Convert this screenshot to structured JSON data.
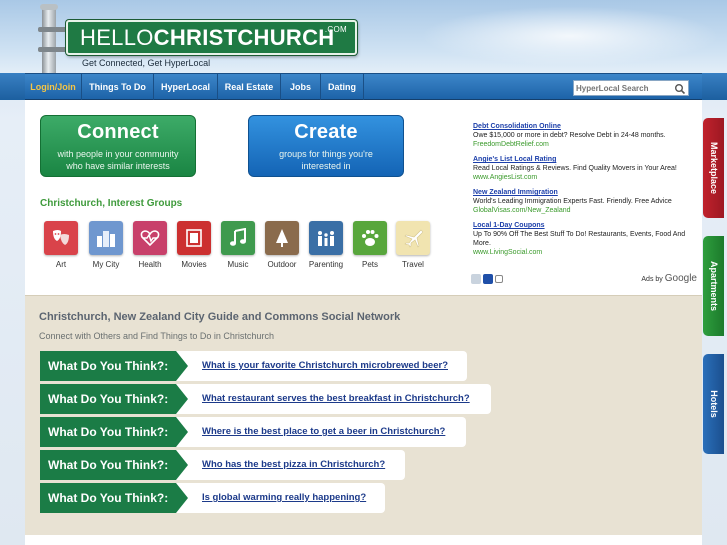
{
  "header": {
    "logo_part1": "HELLO",
    "logo_part2": "CHRISTCHURCH",
    "logo_suffix": ".COM",
    "tagline": "Get Connected, Get HyperLocal"
  },
  "nav": {
    "items": [
      {
        "label": "Login/Join"
      },
      {
        "label": "Things To Do"
      },
      {
        "label": "HyperLocal"
      },
      {
        "label": "Real Estate"
      },
      {
        "label": "Jobs"
      },
      {
        "label": "Dating"
      }
    ],
    "search_placeholder": "HyperLocal Search"
  },
  "connect": {
    "title": "Connect",
    "line1": "with people in your community",
    "line2": "who have similar interests"
  },
  "create": {
    "title": "Create",
    "line1": "groups for things you're",
    "line2": "interested in"
  },
  "groups": {
    "title": "Christchurch, Interest Groups",
    "items": [
      {
        "label": "Art",
        "icon": "masks-icon",
        "color": "#d9434a"
      },
      {
        "label": "My City",
        "icon": "city-icon",
        "color": "#6f97cf"
      },
      {
        "label": "Health",
        "icon": "heart-icon",
        "color": "#c8406a"
      },
      {
        "label": "Movies",
        "icon": "film-icon",
        "color": "#cc3030"
      },
      {
        "label": "Music",
        "icon": "music-note-icon",
        "color": "#3f9a4e"
      },
      {
        "label": "Outdoor",
        "icon": "tree-icon",
        "color": "#8a6b4c"
      },
      {
        "label": "Parenting",
        "icon": "family-icon",
        "color": "#3a6fa6"
      },
      {
        "label": "Pets",
        "icon": "paw-icon",
        "color": "#58a63c"
      },
      {
        "label": "Travel",
        "icon": "plane-icon",
        "color": "#f1e4b0"
      }
    ]
  },
  "ads": {
    "items": [
      {
        "title": "Debt Consolidation Online",
        "body": "Owe $15,000 or more in debt? Resolve Debt in 24-48 months.",
        "url": "FreedomDebtRelief.com"
      },
      {
        "title": "Angie's List Local Rating",
        "body": "Read Local Ratings & Reviews. Find Quality Movers in Your Area!",
        "url": "www.AngiesList.com"
      },
      {
        "title": "New Zealand Immigration",
        "body": "World's Leading Immigration Experts Fast. Friendly. Free Advice",
        "url": "GlobalVisas.com/New_Zealand"
      },
      {
        "title": "Local 1-Day Coupons",
        "body": "Up To 90% Off The Best Stuff To Do! Restaurants, Events, Food And More.",
        "url": "www.LivingSocial.com"
      }
    ],
    "ads_by": "Ads by",
    "google": "Google"
  },
  "city": {
    "title": "Christchurch, New Zealand City Guide and Commons Social Network",
    "subtitle": "Connect with Others and Find Things to Do in Christchurch"
  },
  "questions": {
    "tag": "What Do You Think?:",
    "items": [
      {
        "text": "What is your favorite Christchurch microbrewed beer?"
      },
      {
        "text": "What restaurant serves the best breakfast in Christchurch?"
      },
      {
        "text": "Where is the best place to get a beer in Christchurch?"
      },
      {
        "text": "Who has the best pizza in Christchurch?"
      },
      {
        "text": "Is global warming really happening?"
      }
    ]
  },
  "side_tabs": {
    "marketplace": "Marketplace",
    "apartments": "Apartments",
    "hotels": "Hotels"
  }
}
